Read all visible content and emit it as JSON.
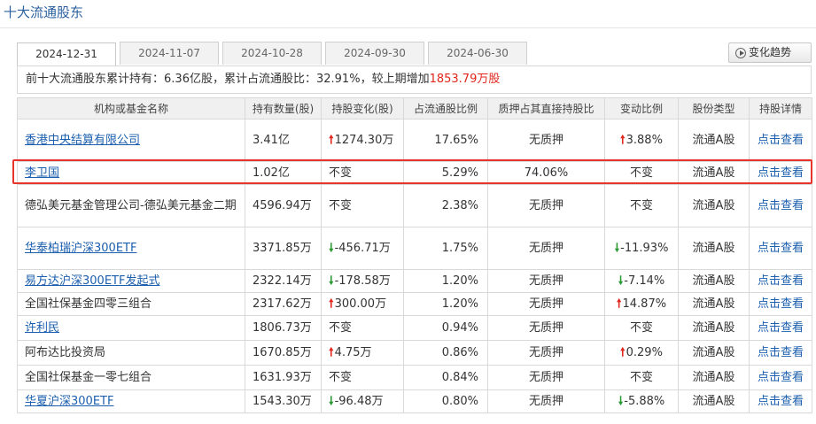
{
  "title": "十大流通股东",
  "tabs": [
    "2024-12-31",
    "2024-11-07",
    "2024-10-28",
    "2024-09-30",
    "2024-06-30"
  ],
  "trend_button": "变化趋势",
  "summary": {
    "prefix": "前十大流通股东累计持有：",
    "holding": "6.36亿股",
    "sep1": "，累计占流通股比：",
    "ratio": "32.91%",
    "sep2": "，较上期增加",
    "change": "1853.79万股"
  },
  "columns": [
    "机构或基金名称",
    "持有数量(股)",
    "持股变化(股)",
    "占流通股比例",
    "质押占其直接持股比",
    "变动比例",
    "股份类型",
    "持股详情"
  ],
  "rows": [
    {
      "name": "香港中央结算有限公司",
      "qty": "3.41亿",
      "change": "1274.30万",
      "change_dir": "up",
      "pct": "17.65%",
      "pledge": "无质押",
      "chg_ratio": "3.88%",
      "ratio_dir": "up",
      "type": "流通A股",
      "detail": "点击查看"
    },
    {
      "name": "李卫国",
      "qty": "1.02亿",
      "change": "不变",
      "change_dir": "none",
      "pct": "5.29%",
      "pledge": "74.06%",
      "chg_ratio": "不变",
      "ratio_dir": "none",
      "type": "流通A股",
      "detail": "点击查看"
    },
    {
      "name": "德弘美元基金管理公司-德弘美元基金二期",
      "qty": "4596.94万",
      "change": "不变",
      "change_dir": "none",
      "pct": "2.38%",
      "pledge": "无质押",
      "chg_ratio": "不变",
      "ratio_dir": "none",
      "type": "流通A股",
      "detail": "点击查看"
    },
    {
      "name": "华泰柏瑞沪深300ETF",
      "qty": "3371.85万",
      "change": "-456.71万",
      "change_dir": "down",
      "pct": "1.75%",
      "pledge": "无质押",
      "chg_ratio": "-11.93%",
      "ratio_dir": "down",
      "type": "流通A股",
      "detail": "点击查看"
    },
    {
      "name": "易方达沪深300ETF发起式",
      "qty": "2322.14万",
      "change": "-178.58万",
      "change_dir": "down",
      "pct": "1.20%",
      "pledge": "无质押",
      "chg_ratio": "-7.14%",
      "ratio_dir": "down",
      "type": "流通A股",
      "detail": "点击查看"
    },
    {
      "name": "全国社保基金四零三组合",
      "qty": "2317.62万",
      "change": "300.00万",
      "change_dir": "up",
      "pct": "1.20%",
      "pledge": "无质押",
      "chg_ratio": "14.87%",
      "ratio_dir": "up",
      "type": "流通A股",
      "detail": "点击查看"
    },
    {
      "name": "许利民",
      "qty": "1806.73万",
      "change": "不变",
      "change_dir": "none",
      "pct": "0.94%",
      "pledge": "无质押",
      "chg_ratio": "不变",
      "ratio_dir": "none",
      "type": "流通A股",
      "detail": "点击查看"
    },
    {
      "name": "阿布达比投资局",
      "qty": "1670.85万",
      "change": "4.75万",
      "change_dir": "up",
      "pct": "0.86%",
      "pledge": "无质押",
      "chg_ratio": "0.29%",
      "ratio_dir": "up",
      "type": "流通A股",
      "detail": "点击查看"
    },
    {
      "name": "全国社保基金一零七组合",
      "qty": "1631.93万",
      "change": "不变",
      "change_dir": "none",
      "pct": "0.84%",
      "pledge": "无质押",
      "chg_ratio": "不变",
      "ratio_dir": "none",
      "type": "流通A股",
      "detail": "点击查看"
    },
    {
      "name": "华夏沪深300ETF",
      "qty": "1543.30万",
      "change": "-96.48万",
      "change_dir": "down",
      "pct": "0.80%",
      "pledge": "无质押",
      "chg_ratio": "-5.88%",
      "ratio_dir": "down",
      "type": "流通A股",
      "detail": "点击查看"
    }
  ],
  "colors": {
    "up": "#e0261b",
    "down": "#2a9a32",
    "link": "#1b5fae",
    "highlight": "#e8352c"
  }
}
